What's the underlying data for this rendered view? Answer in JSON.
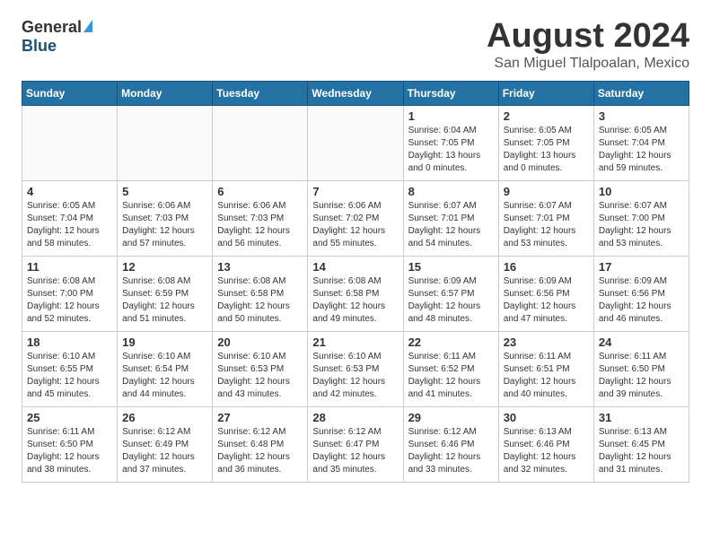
{
  "header": {
    "logo_general": "General",
    "logo_blue": "Blue",
    "month": "August 2024",
    "location": "San Miguel Tlalpoalan, Mexico"
  },
  "days_of_week": [
    "Sunday",
    "Monday",
    "Tuesday",
    "Wednesday",
    "Thursday",
    "Friday",
    "Saturday"
  ],
  "weeks": [
    [
      {
        "day": "",
        "info": ""
      },
      {
        "day": "",
        "info": ""
      },
      {
        "day": "",
        "info": ""
      },
      {
        "day": "",
        "info": ""
      },
      {
        "day": "1",
        "info": "Sunrise: 6:04 AM\nSunset: 7:05 PM\nDaylight: 13 hours\nand 0 minutes."
      },
      {
        "day": "2",
        "info": "Sunrise: 6:05 AM\nSunset: 7:05 PM\nDaylight: 13 hours\nand 0 minutes."
      },
      {
        "day": "3",
        "info": "Sunrise: 6:05 AM\nSunset: 7:04 PM\nDaylight: 12 hours\nand 59 minutes."
      }
    ],
    [
      {
        "day": "4",
        "info": "Sunrise: 6:05 AM\nSunset: 7:04 PM\nDaylight: 12 hours\nand 58 minutes."
      },
      {
        "day": "5",
        "info": "Sunrise: 6:06 AM\nSunset: 7:03 PM\nDaylight: 12 hours\nand 57 minutes."
      },
      {
        "day": "6",
        "info": "Sunrise: 6:06 AM\nSunset: 7:03 PM\nDaylight: 12 hours\nand 56 minutes."
      },
      {
        "day": "7",
        "info": "Sunrise: 6:06 AM\nSunset: 7:02 PM\nDaylight: 12 hours\nand 55 minutes."
      },
      {
        "day": "8",
        "info": "Sunrise: 6:07 AM\nSunset: 7:01 PM\nDaylight: 12 hours\nand 54 minutes."
      },
      {
        "day": "9",
        "info": "Sunrise: 6:07 AM\nSunset: 7:01 PM\nDaylight: 12 hours\nand 53 minutes."
      },
      {
        "day": "10",
        "info": "Sunrise: 6:07 AM\nSunset: 7:00 PM\nDaylight: 12 hours\nand 53 minutes."
      }
    ],
    [
      {
        "day": "11",
        "info": "Sunrise: 6:08 AM\nSunset: 7:00 PM\nDaylight: 12 hours\nand 52 minutes."
      },
      {
        "day": "12",
        "info": "Sunrise: 6:08 AM\nSunset: 6:59 PM\nDaylight: 12 hours\nand 51 minutes."
      },
      {
        "day": "13",
        "info": "Sunrise: 6:08 AM\nSunset: 6:58 PM\nDaylight: 12 hours\nand 50 minutes."
      },
      {
        "day": "14",
        "info": "Sunrise: 6:08 AM\nSunset: 6:58 PM\nDaylight: 12 hours\nand 49 minutes."
      },
      {
        "day": "15",
        "info": "Sunrise: 6:09 AM\nSunset: 6:57 PM\nDaylight: 12 hours\nand 48 minutes."
      },
      {
        "day": "16",
        "info": "Sunrise: 6:09 AM\nSunset: 6:56 PM\nDaylight: 12 hours\nand 47 minutes."
      },
      {
        "day": "17",
        "info": "Sunrise: 6:09 AM\nSunset: 6:56 PM\nDaylight: 12 hours\nand 46 minutes."
      }
    ],
    [
      {
        "day": "18",
        "info": "Sunrise: 6:10 AM\nSunset: 6:55 PM\nDaylight: 12 hours\nand 45 minutes."
      },
      {
        "day": "19",
        "info": "Sunrise: 6:10 AM\nSunset: 6:54 PM\nDaylight: 12 hours\nand 44 minutes."
      },
      {
        "day": "20",
        "info": "Sunrise: 6:10 AM\nSunset: 6:53 PM\nDaylight: 12 hours\nand 43 minutes."
      },
      {
        "day": "21",
        "info": "Sunrise: 6:10 AM\nSunset: 6:53 PM\nDaylight: 12 hours\nand 42 minutes."
      },
      {
        "day": "22",
        "info": "Sunrise: 6:11 AM\nSunset: 6:52 PM\nDaylight: 12 hours\nand 41 minutes."
      },
      {
        "day": "23",
        "info": "Sunrise: 6:11 AM\nSunset: 6:51 PM\nDaylight: 12 hours\nand 40 minutes."
      },
      {
        "day": "24",
        "info": "Sunrise: 6:11 AM\nSunset: 6:50 PM\nDaylight: 12 hours\nand 39 minutes."
      }
    ],
    [
      {
        "day": "25",
        "info": "Sunrise: 6:11 AM\nSunset: 6:50 PM\nDaylight: 12 hours\nand 38 minutes."
      },
      {
        "day": "26",
        "info": "Sunrise: 6:12 AM\nSunset: 6:49 PM\nDaylight: 12 hours\nand 37 minutes."
      },
      {
        "day": "27",
        "info": "Sunrise: 6:12 AM\nSunset: 6:48 PM\nDaylight: 12 hours\nand 36 minutes."
      },
      {
        "day": "28",
        "info": "Sunrise: 6:12 AM\nSunset: 6:47 PM\nDaylight: 12 hours\nand 35 minutes."
      },
      {
        "day": "29",
        "info": "Sunrise: 6:12 AM\nSunset: 6:46 PM\nDaylight: 12 hours\nand 33 minutes."
      },
      {
        "day": "30",
        "info": "Sunrise: 6:13 AM\nSunset: 6:46 PM\nDaylight: 12 hours\nand 32 minutes."
      },
      {
        "day": "31",
        "info": "Sunrise: 6:13 AM\nSunset: 6:45 PM\nDaylight: 12 hours\nand 31 minutes."
      }
    ]
  ]
}
